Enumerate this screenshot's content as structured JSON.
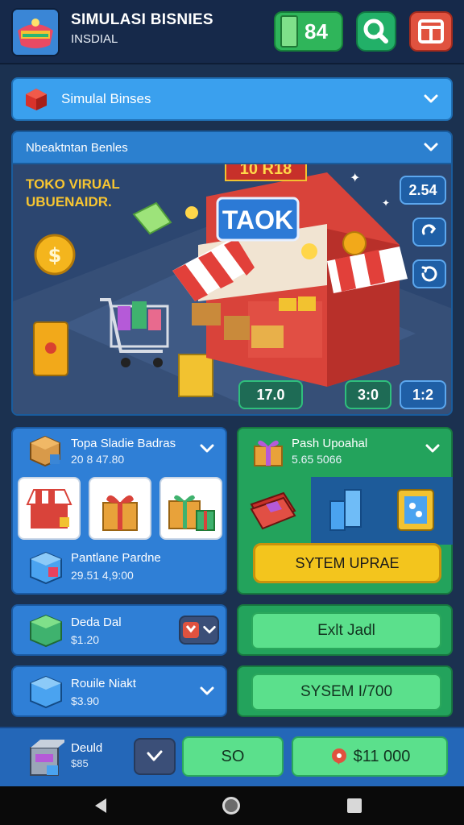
{
  "header": {
    "title": "SIMULASI BISNIES",
    "subtitle": "INSDIAL",
    "money": "84",
    "icons": [
      "app-logo",
      "cash-icon",
      "search-icon",
      "menu-icon"
    ]
  },
  "dropdown_main": {
    "label": "Simulal Binses",
    "icon": "cube-icon"
  },
  "dropdown_section": {
    "label": "Nbeaktntan Benles"
  },
  "scene": {
    "title": "TOKO VIRUAL UBUENAIDR.",
    "shop_sign": "TAOK",
    "roof_sign": "10 R18",
    "badge_time": "2.54",
    "badge_a": "17.0",
    "badge_b": "3:0",
    "badge_c": "1:2"
  },
  "panel_shop": {
    "title": "Topa Sladie Badras",
    "sub": "20 8 47.80",
    "item_title": "Pantlane Pardne",
    "item_sub": "29.51 4,9:00"
  },
  "panel_upgrade": {
    "title": "Pash Upoahal",
    "sub": "5.65 5066",
    "button": "SYTEM UPRAE"
  },
  "panel_deal": {
    "title": "Deda Dal",
    "sub": "$1.20"
  },
  "panel_market": {
    "title": "Rouile Niakt",
    "sub": "$3.90"
  },
  "buttons": {
    "exit": "Exlt Jadl",
    "system": "SYSEM I/700"
  },
  "bottom": {
    "title": "Deuld",
    "sub": "$85",
    "btn_mid": "SO",
    "btn_right": "$11 000"
  },
  "colors": {
    "background": "#1b3150",
    "accent_blue": "#3aa0ee",
    "accent_green": "#23a35c",
    "accent_yellow": "#f3c51d",
    "accent_red": "#e0523f"
  }
}
